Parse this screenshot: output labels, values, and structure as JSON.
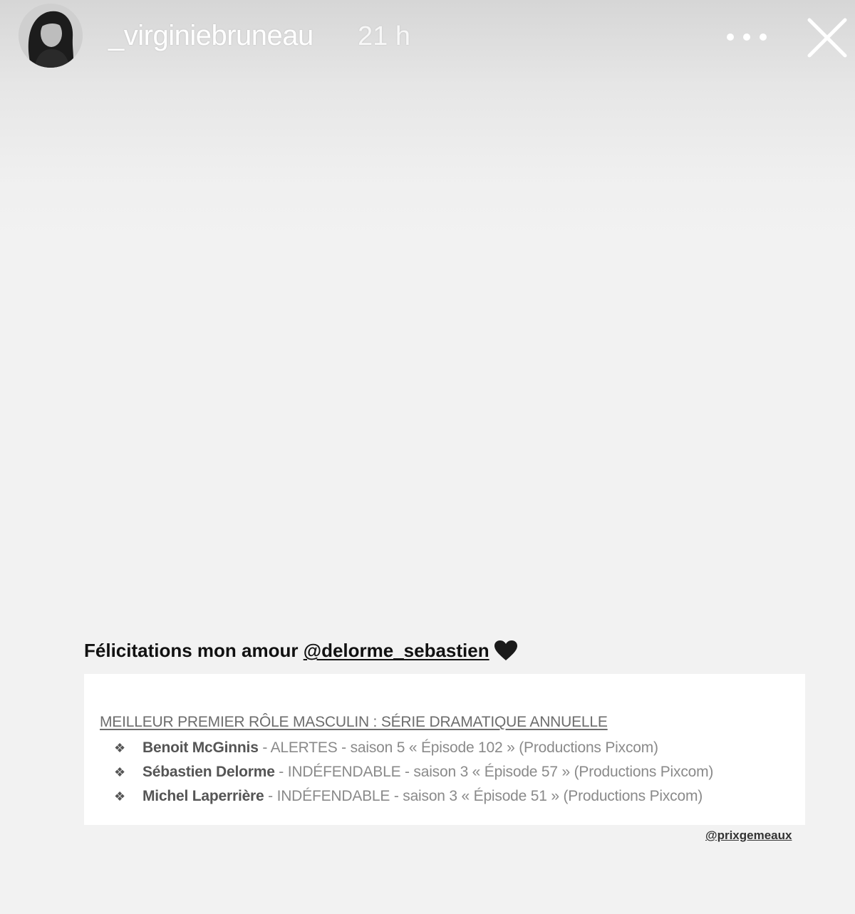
{
  "story": {
    "username": "_virginiebruneau",
    "time": "21 h"
  },
  "caption": {
    "text": "Félicitations mon amour ",
    "mention": "@delorme_sebastien"
  },
  "card": {
    "title": "MEILLEUR PREMIER RÔLE MASCULIN : SÉRIE DRAMATIQUE ANNUELLE",
    "nominees": [
      {
        "name": "Benoit McGinnis",
        "detail": " - ALERTES - saison 5 « Épisode 102 » (Productions Pixcom)"
      },
      {
        "name": "Sébastien Delorme",
        "detail": " - INDÉFENDABLE - saison 3 « Épisode 57 » (Productions Pixcom)"
      },
      {
        "name": "Michel Laperrière",
        "detail": " - INDÉFENDABLE - saison 3 « Épisode 51 » (Productions Pixcom)"
      }
    ],
    "credit": "@prixgemeaux"
  },
  "icons": {
    "avatar": "avatar-photo",
    "more": "more-options-icon",
    "close": "close-icon",
    "heart": "black-heart-icon",
    "bullet": "diamond-bullet-icon"
  }
}
